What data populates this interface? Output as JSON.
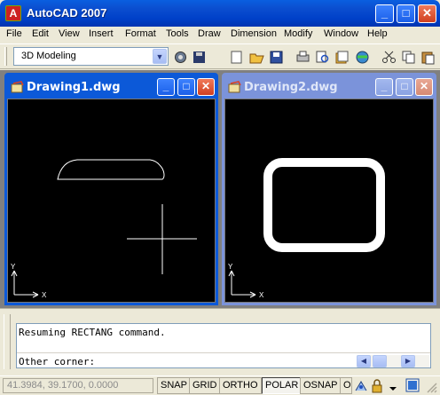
{
  "window": {
    "title": "AutoCAD 2007",
    "app_icon_glyph": "A",
    "minimize_glyph": "_",
    "maximize_glyph": "□",
    "close_glyph": "✕"
  },
  "menu": [
    "File",
    "Edit",
    "View",
    "Insert",
    "Format",
    "Tools",
    "Draw",
    "Dimension",
    "Modify",
    "Window",
    "Help"
  ],
  "toolbar": {
    "workspace_value": "3D Modeling",
    "dropdown_glyph": "▼",
    "icons": [
      "workspace-settings-icon",
      "workspace-save-icon",
      "new-icon",
      "open-icon",
      "save-icon",
      "plot-icon",
      "plot-preview-icon",
      "publish-icon",
      "3d-dwf-icon",
      "cut-icon",
      "copy-icon",
      "paste-icon"
    ]
  },
  "drawings": [
    {
      "title": "Drawing1.dwg",
      "active": true
    },
    {
      "title": "Drawing2.dwg",
      "active": false
    }
  ],
  "ucs": {
    "x_label": "X",
    "y_label": "Y"
  },
  "command": {
    "history": "Resuming RECTANG command.",
    "prompt": "Other corner:",
    "scroll_left_glyph": "◀",
    "scroll_right_glyph": "▶"
  },
  "status": {
    "coordinates": "41.3984, 39.1700, 0.0000",
    "buttons": [
      {
        "label": "SNAP",
        "on": false
      },
      {
        "label": "GRID",
        "on": false
      },
      {
        "label": "ORTHO",
        "on": false
      },
      {
        "label": "POLAR",
        "on": true
      },
      {
        "label": "OSNAP",
        "on": false
      },
      {
        "label": "O",
        "on": false
      }
    ]
  },
  "colors": {
    "title_blue": "#0040c8",
    "canvas": "#000000",
    "geometry": "#ffffff"
  }
}
